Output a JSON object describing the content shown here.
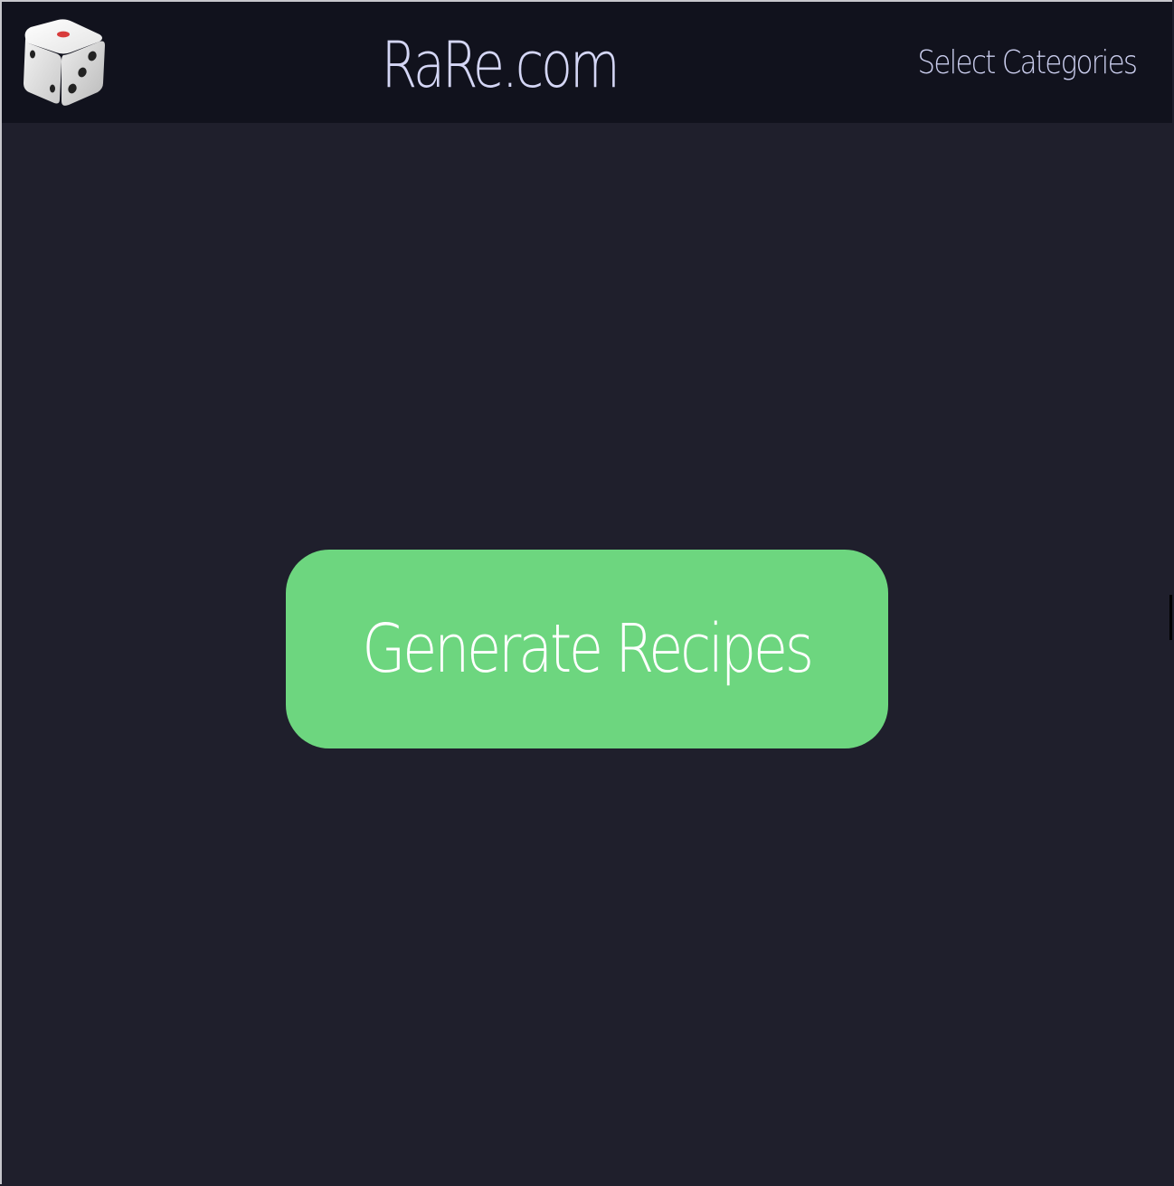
{
  "header": {
    "logo_icon": "dice-icon",
    "title": "RaRe.com",
    "nav_link": "Select Categories"
  },
  "main": {
    "generate_button": "Generate Recipes"
  },
  "colors": {
    "page_background": "#1f1f2c",
    "header_background": "#11121d",
    "title_text": "#d4d6f5",
    "button_background": "#6dd67f",
    "button_text": "#ffffff"
  }
}
